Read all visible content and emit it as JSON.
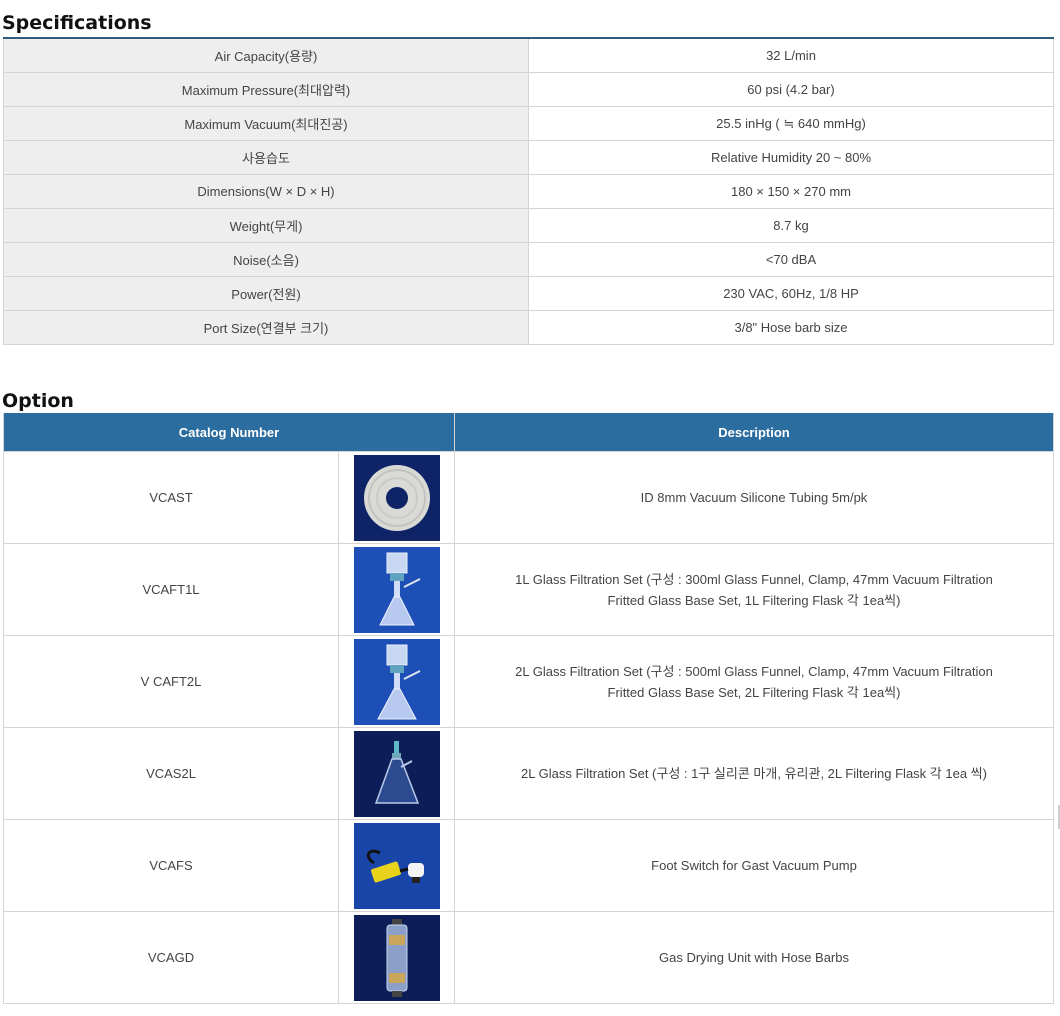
{
  "specifications": {
    "title": "Specifications",
    "rows": [
      {
        "label": "Air Capacity(용량)",
        "value": "32 L/min"
      },
      {
        "label": "Maximum Pressure(최대압력)",
        "value": "60 psi (4.2 bar)"
      },
      {
        "label": "Maximum Vacuum(최대진공)",
        "value": "25.5 inHg ( ≒ 640 mmHg)"
      },
      {
        "label": "사용습도",
        "value": "Relative Humidity 20 ~ 80%"
      },
      {
        "label": "Dimensions(W × D × H)",
        "value": "180 × 150 × 270 mm"
      },
      {
        "label": "Weight(무게)",
        "value": "8.7 kg"
      },
      {
        "label": "Noise(소음)",
        "value": "<70 dBA"
      },
      {
        "label": "Power(전원)",
        "value": "230 VAC, 60Hz, 1/8 HP"
      },
      {
        "label": "Port Size(연결부 크기)",
        "value": "3/8\" Hose barb size"
      }
    ]
  },
  "option": {
    "title": "Option",
    "headers": {
      "catalog": "Catalog Number",
      "description": "Description"
    },
    "rows": [
      {
        "catalog": "VCAST",
        "description": [
          "ID 8mm Vacuum Silicone Tubing 5m/pk"
        ],
        "image": "silicone-tubing-coil"
      },
      {
        "catalog": "VCAFT1L",
        "description": [
          "1L Glass Filtration Set (구성 : 300ml Glass Funnel, Clamp, 47mm Vacuum Filtration",
          "Fritted Glass Base Set, 1L Filtering Flask 각 1ea씩)"
        ],
        "image": "glass-filtration-set"
      },
      {
        "catalog": "V CAFT2L",
        "description": [
          "2L Glass Filtration Set (구성 : 500ml Glass Funnel, Clamp, 47mm Vacuum Filtration",
          "Fritted Glass Base Set, 2L Filtering Flask 각 1ea씩)"
        ],
        "image": "glass-filtration-set"
      },
      {
        "catalog": "VCAS2L",
        "description": [
          "2L Glass Filtration Set (구성 : 1구 실리콘 마개, 유리관, 2L Filtering Flask 각 1ea 씩)"
        ],
        "image": "filtering-flask"
      },
      {
        "catalog": "VCAFS",
        "description": [
          "Foot Switch for Gast Vacuum Pump"
        ],
        "image": "foot-switch"
      },
      {
        "catalog": "VCAGD",
        "description": [
          "Gas Drying Unit with Hose Barbs"
        ],
        "image": "gas-drying-unit"
      }
    ]
  }
}
